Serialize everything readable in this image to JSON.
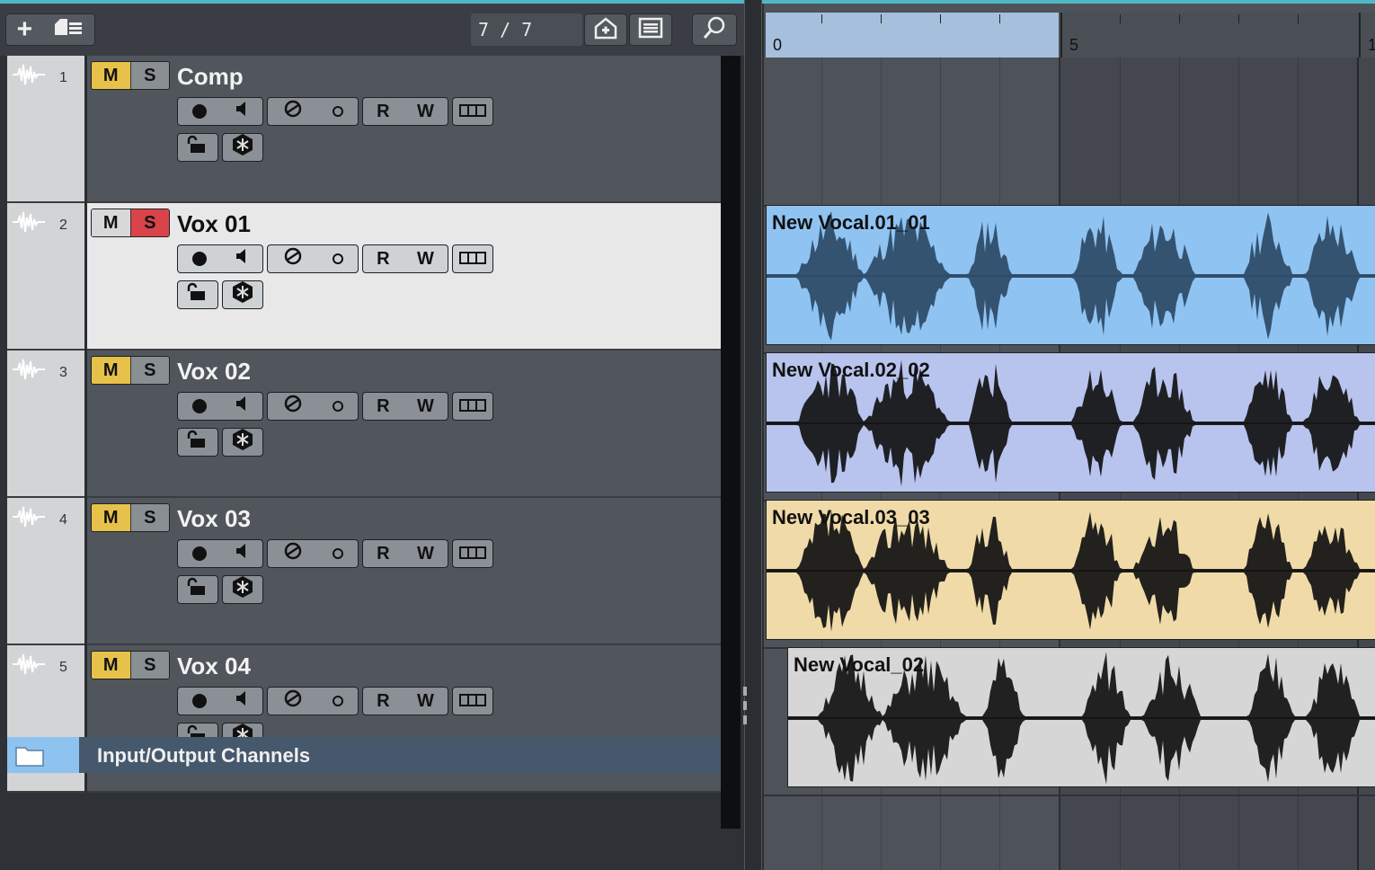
{
  "toolbar": {
    "add_track_icon": "plus-icon",
    "folder_icon": "add-folder-icon",
    "track_counter": "7 / 7",
    "home_icon": "home-icon",
    "list_icon": "list-icon",
    "search_icon": "search-icon"
  },
  "tracks": [
    {
      "number": "1",
      "name": "Comp",
      "mute_active": true,
      "solo_active": false,
      "selected": false
    },
    {
      "number": "2",
      "name": "Vox 01",
      "mute_active": false,
      "solo_active": true,
      "selected": true
    },
    {
      "number": "3",
      "name": "Vox 02",
      "mute_active": true,
      "solo_active": false,
      "selected": false
    },
    {
      "number": "4",
      "name": "Vox 03",
      "mute_active": true,
      "solo_active": false,
      "selected": false
    },
    {
      "number": "5",
      "name": "Vox 04",
      "mute_active": true,
      "solo_active": false,
      "selected": false
    }
  ],
  "track_buttons": {
    "mute": "M",
    "solo": "S",
    "read": "R",
    "write": "W"
  },
  "io_folder": {
    "label": "Input/Output Channels"
  },
  "ruler": {
    "marks": [
      "0",
      "5",
      "1"
    ]
  },
  "events": [
    {
      "name": "New Vocal.01_01",
      "color": "#8fc3f2"
    },
    {
      "name": "New Vocal.02_02",
      "color": "#b8c4ee"
    },
    {
      "name": "New Vocal.03_03",
      "color": "#f0dba8"
    },
    {
      "name": "New Vocal_02",
      "color": "#d6d6d6"
    }
  ],
  "colors": {
    "mute": "#e6c24a",
    "solo_on": "#d9434a",
    "accent": "#4fb7c3"
  }
}
